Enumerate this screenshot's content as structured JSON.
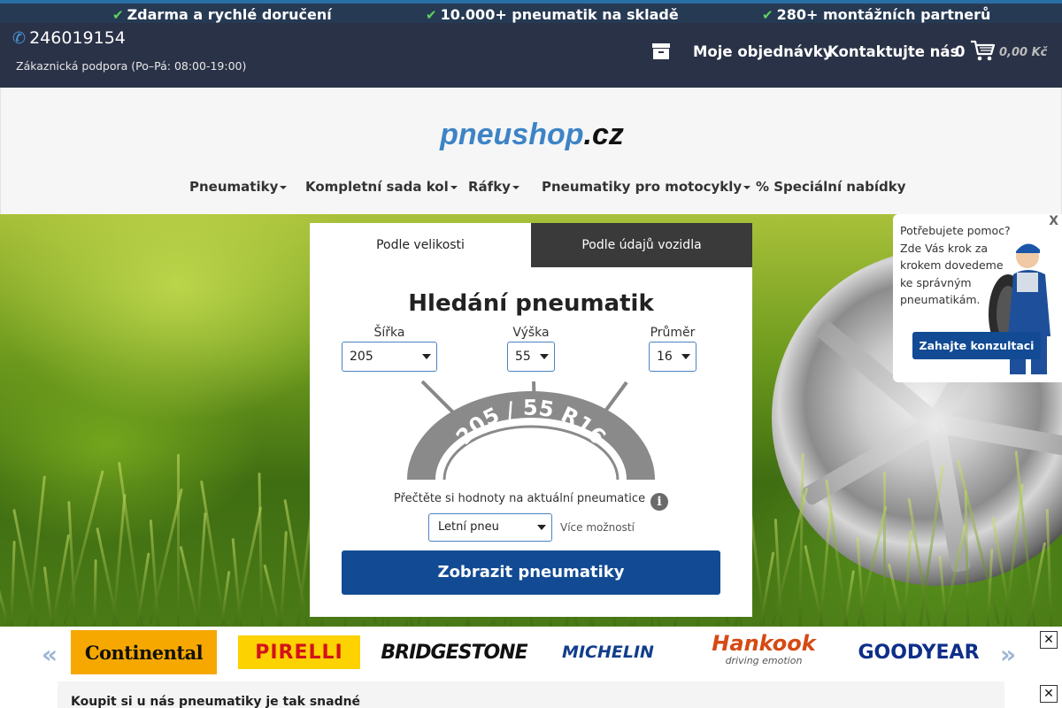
{
  "promo": {
    "item1": "Zdarma a rychlé doručení",
    "item2": "10.000+ pneumatik na skladě",
    "item3": "280+ montážních partnerů"
  },
  "header": {
    "phone": "246019154",
    "support": "Zákaznická podpora (Po–Pá: 08:00-19:00)",
    "orders": "Moje objednávky",
    "contact": "Kontaktujte nás",
    "cart_count": "0",
    "cart_total": "0,00 Kč"
  },
  "logo": {
    "main": "pneushop",
    "tld": ".cz"
  },
  "main_nav": [
    {
      "label": "Pneumatiky",
      "dropdown": true
    },
    {
      "label": "Kompletní sada kol",
      "dropdown": true
    },
    {
      "label": "Ráfky",
      "dropdown": true
    },
    {
      "label": "Pneumatiky pro motocykly",
      "dropdown": true
    },
    {
      "label": "% Speciální nabídky",
      "dropdown": false
    }
  ],
  "search": {
    "tabs": [
      "Podle velikosti",
      "Podle údajů vozidla"
    ],
    "active_tab": 0,
    "title": "Hledání pneumatik",
    "width_label": "Šířka",
    "width_value": "205",
    "height_label": "Výška",
    "height_value": "55",
    "diameter_label": "Průměr",
    "diameter_value": "16",
    "diagram_text": "205 / 55 R16",
    "hint": "Přečtěte si hodnoty na aktuální pneumatice",
    "season_value": "Letní pneu",
    "more_options": "Více možností",
    "submit": "Zobrazit pneumatiky"
  },
  "help_widget": {
    "close": "X",
    "text": "Potřebujete pomoc? Zde Vás krok za krokem dovedeme ke správným pneumatikám.",
    "button": "Zahajte konzultaci"
  },
  "brands": {
    "prev": "«",
    "next": "»",
    "items": [
      "Continental",
      "PIRELLI",
      "BRIDGESTONE",
      "MICHELIN",
      "Hankook",
      "GOODYEAR"
    ],
    "hankook_tagline": "driving emotion"
  },
  "bottom": {
    "text": "Koupit si u nás pneumatiky je tak snadné"
  },
  "icons": {
    "check": "check-icon",
    "phone": "phone-icon",
    "orders": "box-icon",
    "cart": "cart-icon",
    "info": "info-icon",
    "close": "close-icon"
  },
  "colors": {
    "header_bg": "#2a3247",
    "primary_button": "#124b94",
    "check": "#5fd35f",
    "logo_blue": "#3d84c6"
  }
}
